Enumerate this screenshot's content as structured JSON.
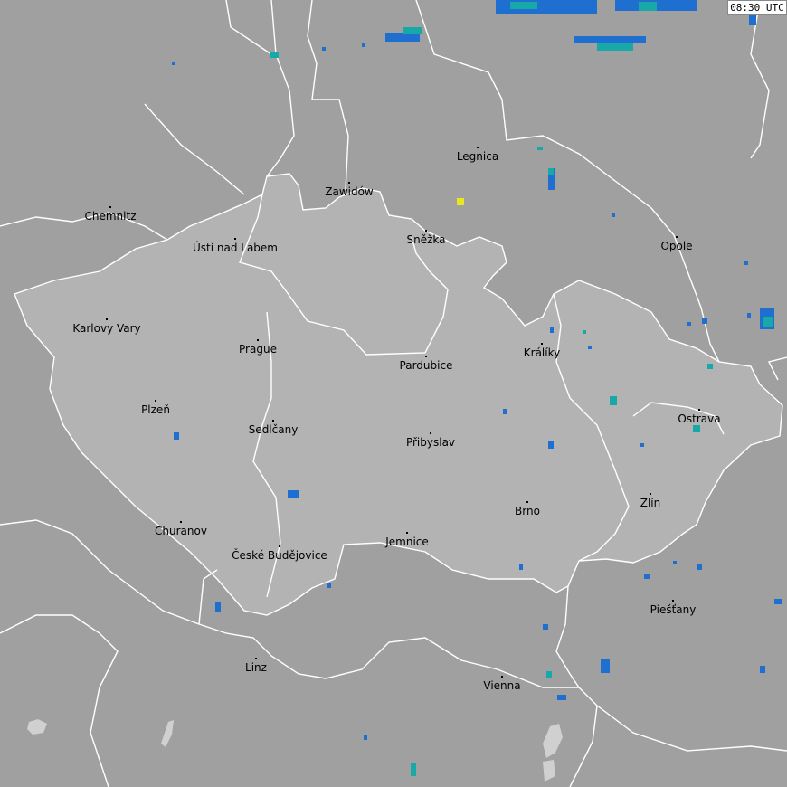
{
  "timestamp": "08:30 UTC",
  "colors": {
    "background": "#a0a0a0",
    "highlight_region": "#b3b3b3",
    "border": "#ffffff",
    "water": "#d0d0d0",
    "strike_blue": "#1e6fd0",
    "strike_teal": "#18a8a8",
    "strike_yellow": "#e8e820"
  },
  "cities": [
    {
      "name": "Chemnitz"
    },
    {
      "name": "Zawidów"
    },
    {
      "name": "Legnica"
    },
    {
      "name": "Ústí nad Labem"
    },
    {
      "name": "Sněžka"
    },
    {
      "name": "Opole"
    },
    {
      "name": "Karlovy Vary"
    },
    {
      "name": "Prague"
    },
    {
      "name": "Králíky"
    },
    {
      "name": "Pardubice"
    },
    {
      "name": "Plzeň"
    },
    {
      "name": "Ostrava"
    },
    {
      "name": "Sedlčany"
    },
    {
      "name": "Přibyslav"
    },
    {
      "name": "Zlín"
    },
    {
      "name": "Brno"
    },
    {
      "name": "Churanov"
    },
    {
      "name": "České Budějovice"
    },
    {
      "name": "Jemnice"
    },
    {
      "name": "Piešťany"
    },
    {
      "name": "Linz"
    },
    {
      "name": "Vienna"
    }
  ]
}
